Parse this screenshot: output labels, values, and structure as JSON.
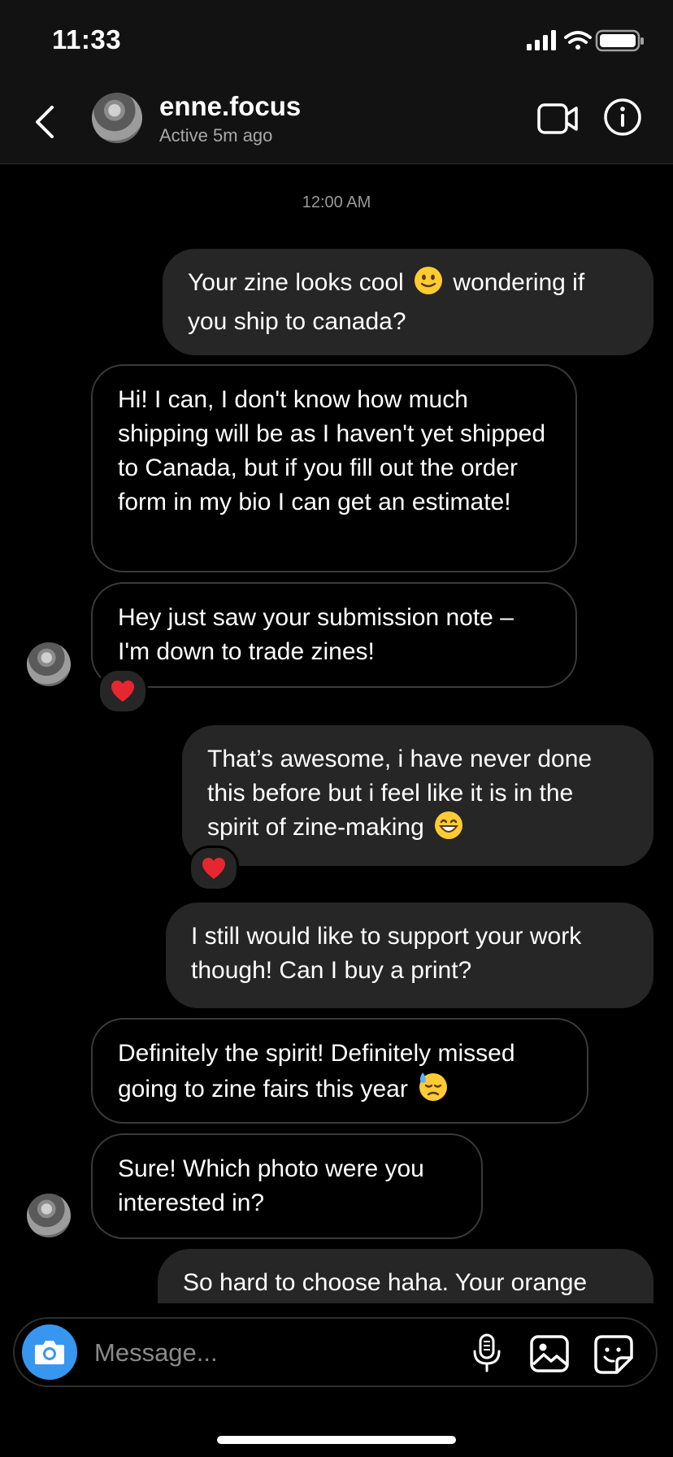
{
  "status_bar": {
    "time": "11:33"
  },
  "header": {
    "username": "enne.focus",
    "presence": "Active 5m ago"
  },
  "chat": {
    "timestamp": "12:00 AM",
    "messages": [
      {
        "from": "me",
        "parts": [
          "Your zine looks cool",
          "wondering if you ship to canada?"
        ],
        "emoji": "slightly-smiling-face-emoji"
      },
      {
        "from": "them",
        "text": "Hi! I can, I don't know how much shipping will be as I haven't yet shipped to Canada, but if you fill out the order form in my bio I can get an estimate!"
      },
      {
        "from": "them",
        "text": "Hey just saw your submission note – I'm down to trade zines!",
        "reaction": "heart"
      },
      {
        "from": "me",
        "text": "That’s awesome, i have never done this before but i feel like it is in the spirit of zine-making",
        "emoji": "grinning-face-emoji",
        "reaction": "heart"
      },
      {
        "from": "me",
        "text": "I still would like to support your work though! Can I buy a print?"
      },
      {
        "from": "them",
        "text": "Definitely the spirit! Definitely missed going to zine fairs this year",
        "emoji": "downcast-face-with-sweat-emoji"
      },
      {
        "from": "them",
        "text": "Sure! Which photo were you interested in?"
      },
      {
        "from": "me",
        "text": "So hard to choose haha. Your orange"
      }
    ]
  },
  "composer": {
    "placeholder": "Message..."
  },
  "colors": {
    "background": "#000000",
    "sent_bubble": "#262626",
    "camera_button": "#3797f0",
    "heart": "#e8262f"
  },
  "icons": [
    "back-chevron-icon",
    "video-call-icon",
    "info-icon",
    "camera-icon",
    "microphone-icon",
    "gallery-icon",
    "sticker-icon",
    "heart-icon"
  ]
}
